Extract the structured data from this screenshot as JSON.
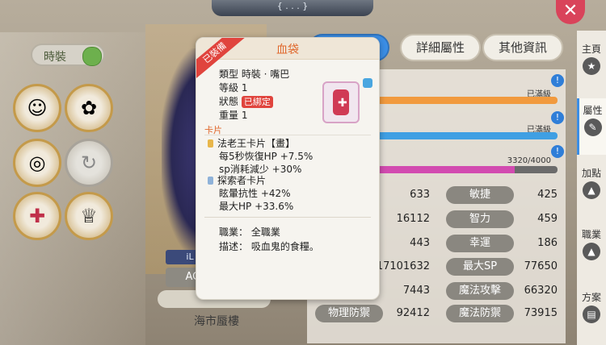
{
  "close": {
    "label": "✕"
  },
  "left": {
    "toggle_label": "時裝",
    "slots": [
      {
        "icon": "☺",
        "empty": false
      },
      {
        "icon": "✿",
        "empty": false
      },
      {
        "icon": "◎",
        "empty": false
      },
      {
        "icon": "↻",
        "empty": true
      },
      {
        "icon": "✚",
        "empty": false
      },
      {
        "icon": "♕",
        "empty": false
      }
    ]
  },
  "character": {
    "guild_text": "iL",
    "title_badge": "AGL",
    "name": "海市蜃樓",
    "top_text": "{ . . . }"
  },
  "tabs": [
    {
      "label": "",
      "active": true
    },
    {
      "label": "詳細屬性",
      "active": false
    },
    {
      "label": "其他資訊",
      "active": false
    }
  ],
  "bars": [
    {
      "text": "已滿級",
      "fill": 1.0,
      "color": "#f19a3e"
    },
    {
      "text": "已滿級",
      "fill": 1.0,
      "color": "#3f9fe3"
    },
    {
      "text": "3320/4000",
      "fill": 0.83,
      "color": "#d24bb0"
    }
  ],
  "stats": [
    {
      "left_value": "633",
      "right_label": "敏捷",
      "right_value": "425"
    },
    {
      "left_value": "16112",
      "right_label": "智力",
      "right_value": "459"
    },
    {
      "left_value": "443",
      "right_label": "幸運",
      "right_value": "186"
    },
    {
      "left_value": "617101632",
      "right_label": "最大SP",
      "right_value": "77650"
    },
    {
      "left_value": "7443",
      "right_label": "魔法攻擊",
      "right_value": "66320"
    },
    {
      "left_label": "物理防禦",
      "left_value": "92412",
      "right_label": "魔法防禦",
      "right_value": "73915"
    }
  ],
  "side_menu": [
    {
      "label": "主頁",
      "icon": "★",
      "active": false
    },
    {
      "label": "屬性",
      "icon": "✎",
      "active": true
    },
    {
      "label": "加點",
      "icon": "▲",
      "active": false
    },
    {
      "label": "職業",
      "icon": "▲",
      "active": false
    },
    {
      "label": "方案",
      "icon": "▤",
      "active": false
    }
  ],
  "tooltip": {
    "title": "血袋",
    "ribbon": "已裝備",
    "type_line": "類型  時裝 · 嘴巴",
    "level_line": "等級 1",
    "status_label": "狀態",
    "status_badge": "已綁定",
    "weight_line": "重量 1",
    "card_section": "卡片",
    "cards": [
      {
        "name": "法老王卡片【畫】",
        "color": "#e8b64a",
        "effects": [
          "每5秒恢復HP +7.5%",
          "sp消耗減少 +30%"
        ]
      },
      {
        "name": "探索者卡片",
        "color": "#8fb2d9",
        "effects": [
          "眩暈抗性 +42%",
          "最大HP +33.6%"
        ]
      }
    ],
    "job_line": "職業：  全職業",
    "desc_line": "描述：  吸血鬼的食糧。"
  }
}
